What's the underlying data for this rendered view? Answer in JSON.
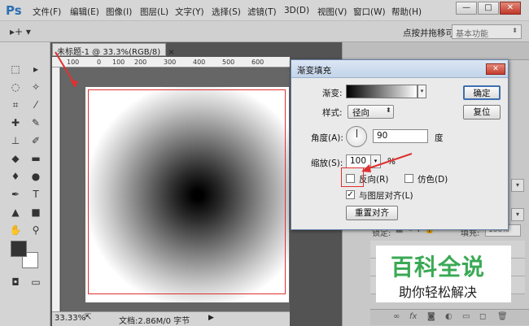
{
  "app": {
    "logo": "Ps",
    "menu": [
      "文件(F)",
      "编辑(E)",
      "图像(I)",
      "图层(L)",
      "文字(Y)",
      "选择(S)",
      "滤镜(T)",
      "3D(D)",
      "视图(V)",
      "窗口(W)",
      "帮助(H)"
    ],
    "window_controls": [
      "—",
      "□",
      "✕"
    ]
  },
  "options_bar": {
    "move_tool": "▸+ ▾",
    "hint": "点按并拖移可",
    "workspace": "基本功能"
  },
  "document": {
    "tab_title": "未标题-1 @ 33.3%(RGB/8)",
    "tab_close": "×",
    "ruler_ticks": [
      "100",
      "0",
      "100",
      "200",
      "300",
      "400",
      "500",
      "600",
      "700"
    ],
    "status_zoom": "33.33%",
    "status_doc": "文档:2.86M/0 字节"
  },
  "dialog": {
    "title": "渐变填充",
    "close": "✕",
    "gradient_label": "渐变:",
    "style_label": "样式:",
    "style_value": "径向",
    "angle_label": "角度(A):",
    "angle_value": "90",
    "angle_unit": "度",
    "scale_label": "缩放(S):",
    "scale_value": "100",
    "scale_unit": "%",
    "reverse_label": "反向(R)",
    "dither_label": "仿色(D)",
    "align_label": "与图层对齐(L)",
    "reset_align_button": "重置对齐",
    "ok_button": "确定",
    "reset_button": "复位",
    "reverse_checked": false,
    "dither_checked": false,
    "align_checked": true
  },
  "layers_panel": {
    "lock_label": "锁定:",
    "fill_label": "填充:",
    "fill_value": "100%"
  },
  "watermark": {
    "main": "百科全说",
    "sub": "助你轻松解决"
  },
  "colors": {
    "accent_green": "#3aa955",
    "highlight_red": "#e03030"
  }
}
